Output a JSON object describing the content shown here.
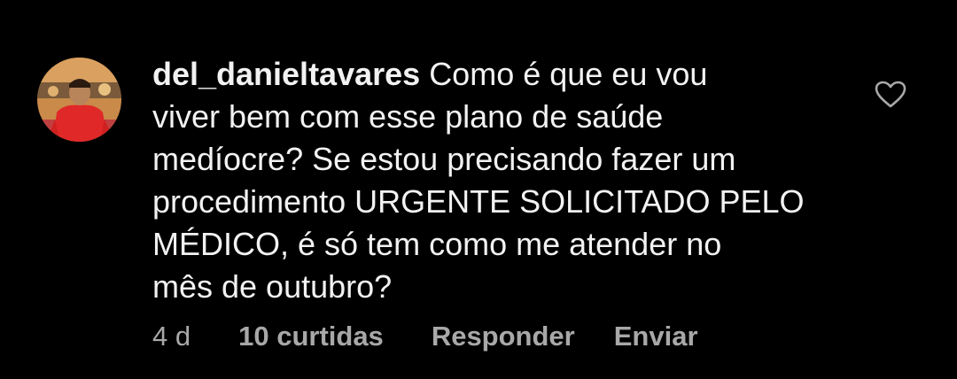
{
  "comment": {
    "username": "del_danieltavares",
    "text_lines": [
      "Como é que eu vou",
      "viver bem com esse plano de saúde",
      "medíocre? Se estou precisando fazer um",
      "procedimento URGENTE SOLICITADO PELO",
      "MÉDICO, é só tem como me atender no",
      "mês de outubro?"
    ],
    "time": "4 d",
    "likes": "10 curtidas",
    "reply_label": "Responder",
    "send_label": "Enviar"
  },
  "icons": {
    "like": "heart-outline-icon",
    "avatar": "profile-avatar"
  },
  "colors": {
    "background": "#000000",
    "primary_text": "#f2f2f2",
    "secondary_text": "#a8a8a8"
  }
}
